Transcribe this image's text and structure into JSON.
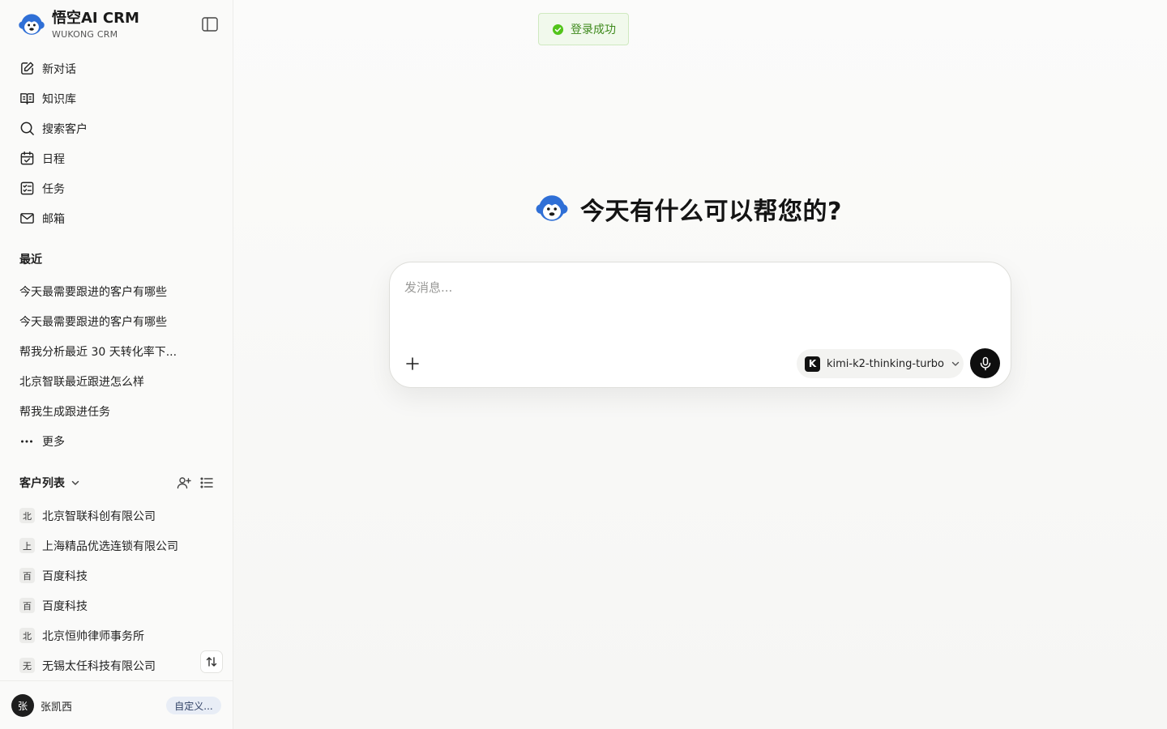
{
  "brand": {
    "title": "悟空AI CRM",
    "subtitle": "WUKONG CRM"
  },
  "nav": [
    {
      "label": "新对话",
      "icon": "edit-icon"
    },
    {
      "label": "知识库",
      "icon": "book-icon"
    },
    {
      "label": "搜索客户",
      "icon": "search-icon"
    },
    {
      "label": "日程",
      "icon": "calendar-icon"
    },
    {
      "label": "任务",
      "icon": "task-list-icon"
    },
    {
      "label": "邮箱",
      "icon": "mail-icon"
    }
  ],
  "recent": {
    "title": "最近",
    "items": [
      "今天最需要跟进的客户有哪些",
      "今天最需要跟进的客户有哪些",
      "帮我分析最近 30 天转化率下...",
      "北京智联最近跟进怎么样",
      "帮我生成跟进任务"
    ],
    "more": "更多"
  },
  "customers": {
    "title": "客户列表",
    "items": [
      {
        "badge": "北",
        "name": "北京智联科创有限公司"
      },
      {
        "badge": "上",
        "name": "上海精品优选连锁有限公司"
      },
      {
        "badge": "百",
        "name": "百度科技"
      },
      {
        "badge": "百",
        "name": "百度科技"
      },
      {
        "badge": "北",
        "name": "北京恒帅律师事务所"
      },
      {
        "badge": "无",
        "name": "无锡太任科技有限公司"
      }
    ]
  },
  "user": {
    "avatar": "张",
    "name": "张凯西",
    "tag": "自定义..."
  },
  "toast": {
    "text": "登录成功",
    "color": "#3f8a1d"
  },
  "hero": {
    "title": "今天有什么可以帮您的?"
  },
  "composer": {
    "placeholder": "发消息...",
    "model_icon": "K",
    "model": "kimi-k2-thinking-turbo"
  },
  "colors": {
    "brand_blue": "#2f6fd6",
    "accent_dark": "#0e0e0e"
  }
}
